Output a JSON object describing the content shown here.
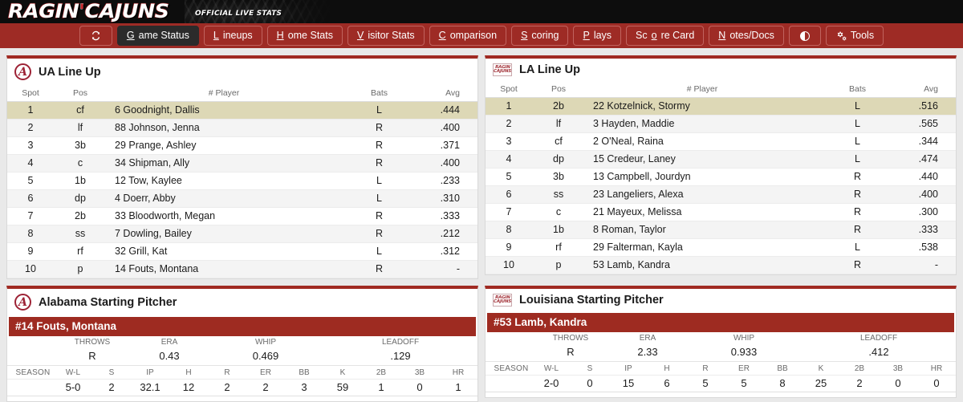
{
  "banner": {
    "wordmark_1": "RAGIN",
    "apostrophe": "'",
    "wordmark_2": "CAJUNS",
    "subtitle": "OFFICIAL LIVE STATS"
  },
  "nav": {
    "refresh_icon": "refresh-icon",
    "contrast_icon": "contrast-icon",
    "gears_icon": "gears-icon",
    "items": [
      {
        "label": "Game Status",
        "accel": "G",
        "rest": "ame Status",
        "active": true
      },
      {
        "label": "Lineups",
        "accel": "L",
        "rest": "ineups",
        "active": false
      },
      {
        "label": "Home Stats",
        "accel": "H",
        "rest": "ome Stats",
        "active": false
      },
      {
        "label": "Visitor Stats",
        "accel": "V",
        "rest": "isitor Stats",
        "active": false
      },
      {
        "label": "Comparison",
        "accel": "C",
        "rest": "omparison",
        "active": false
      },
      {
        "label": "Scoring",
        "accel": "S",
        "rest": "coring",
        "active": false
      },
      {
        "label": "Plays",
        "accel": "P",
        "rest": "lays",
        "active": false
      },
      {
        "label": "Score Card",
        "accel": "o",
        "pre": "Sc",
        "rest": "re Card",
        "active": false
      },
      {
        "label": "Notes/Docs",
        "accel": "N",
        "rest": "otes/Docs",
        "active": false
      }
    ],
    "tools_label": "Tools"
  },
  "lineup_columns": [
    "Spot",
    "Pos",
    "# Player",
    "Bats",
    "Avg"
  ],
  "ua_lineup": {
    "title": "UA Line Up",
    "logo": "alabama-a-logo",
    "rows": [
      {
        "spot": "1",
        "pos": "cf",
        "player": "6 Goodnight, Dallis",
        "bats": "L",
        "avg": ".444"
      },
      {
        "spot": "2",
        "pos": "lf",
        "player": "88 Johnson, Jenna",
        "bats": "R",
        "avg": ".400"
      },
      {
        "spot": "3",
        "pos": "3b",
        "player": "29 Prange, Ashley",
        "bats": "R",
        "avg": ".371"
      },
      {
        "spot": "4",
        "pos": "c",
        "player": "34 Shipman, Ally",
        "bats": "R",
        "avg": ".400"
      },
      {
        "spot": "5",
        "pos": "1b",
        "player": "12 Tow, Kaylee",
        "bats": "L",
        "avg": ".233"
      },
      {
        "spot": "6",
        "pos": "dp",
        "player": "4 Doerr, Abby",
        "bats": "L",
        "avg": ".310"
      },
      {
        "spot": "7",
        "pos": "2b",
        "player": "33 Bloodworth, Megan",
        "bats": "R",
        "avg": ".333"
      },
      {
        "spot": "8",
        "pos": "ss",
        "player": "7 Dowling, Bailey",
        "bats": "R",
        "avg": ".212"
      },
      {
        "spot": "9",
        "pos": "rf",
        "player": "32 Grill, Kat",
        "bats": "L",
        "avg": ".312"
      },
      {
        "spot": "10",
        "pos": "p",
        "player": "14 Fouts, Montana",
        "bats": "R",
        "avg": "-"
      }
    ]
  },
  "la_lineup": {
    "title": "LA Line Up",
    "logo": "ragin-cajuns-logo",
    "logo_text_1": "RAGIN",
    "logo_text_2": "CAJUNS",
    "rows": [
      {
        "spot": "1",
        "pos": "2b",
        "player": "22 Kotzelnick, Stormy",
        "bats": "L",
        "avg": ".516"
      },
      {
        "spot": "2",
        "pos": "lf",
        "player": "3 Hayden, Maddie",
        "bats": "L",
        "avg": ".565"
      },
      {
        "spot": "3",
        "pos": "cf",
        "player": "2 O'Neal, Raina",
        "bats": "L",
        "avg": ".344"
      },
      {
        "spot": "4",
        "pos": "dp",
        "player": "15 Credeur, Laney",
        "bats": "L",
        "avg": ".474"
      },
      {
        "spot": "5",
        "pos": "3b",
        "player": "13 Campbell, Jourdyn",
        "bats": "R",
        "avg": ".440"
      },
      {
        "spot": "6",
        "pos": "ss",
        "player": "23 Langeliers, Alexa",
        "bats": "R",
        "avg": ".400"
      },
      {
        "spot": "7",
        "pos": "c",
        "player": "21 Mayeux, Melissa",
        "bats": "R",
        "avg": ".300"
      },
      {
        "spot": "8",
        "pos": "1b",
        "player": "8 Roman, Taylor",
        "bats": "R",
        "avg": ".333"
      },
      {
        "spot": "9",
        "pos": "rf",
        "player": "29 Falterman, Kayla",
        "bats": "L",
        "avg": ".538"
      },
      {
        "spot": "10",
        "pos": "p",
        "player": "53 Lamb, Kandra",
        "bats": "R",
        "avg": "-"
      }
    ]
  },
  "pitcher_group_headers": [
    "THROWS",
    "ERA",
    "WHIP",
    "LEADOFF"
  ],
  "pitcher_detail_headers": [
    "W-L",
    "S",
    "IP",
    "H",
    "R",
    "ER",
    "BB",
    "K",
    "2B",
    "3B",
    "HR"
  ],
  "pitcher_season_label": "SEASON",
  "ua_pitcher": {
    "title": "Alabama Starting Pitcher",
    "logo": "alabama-a-logo",
    "name_bar": "#14 Fouts, Montana",
    "throws": "R",
    "era": "0.43",
    "whip": "0.469",
    "leadoff": ".129",
    "wl": "5-0",
    "s": "2",
    "ip": "32.1",
    "h": "12",
    "r": "2",
    "er": "2",
    "bb": "3",
    "k": "59",
    "b2": "1",
    "b3": "0",
    "hr": "1"
  },
  "la_pitcher": {
    "title": "Louisiana Starting Pitcher",
    "logo": "ragin-cajuns-logo",
    "name_bar": "#53 Lamb, Kandra",
    "throws": "R",
    "era": "2.33",
    "whip": "0.933",
    "leadoff": ".412",
    "wl": "2-0",
    "s": "0",
    "ip": "15",
    "h": "6",
    "r": "5",
    "er": "5",
    "bb": "8",
    "k": "25",
    "b2": "2",
    "b3": "0",
    "hr": "0"
  },
  "colors": {
    "brand_red": "#9e2b25",
    "panel_top": "#a02a22",
    "highlight_row": "#ddd8b6",
    "alt_row": "#f4f4f4",
    "page_bg": "#e9e9e9"
  }
}
